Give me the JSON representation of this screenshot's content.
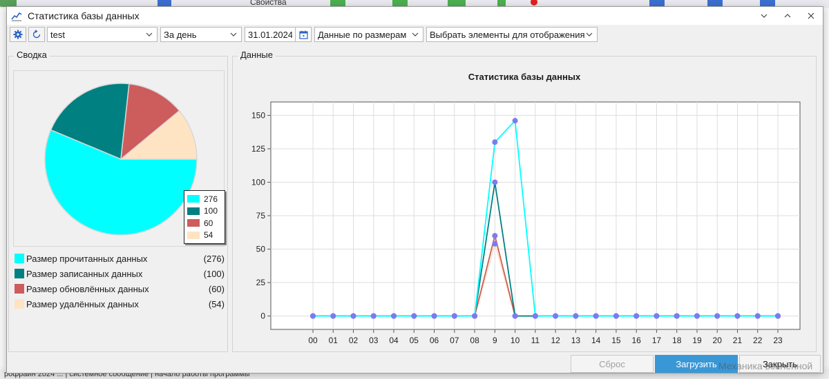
{
  "background": {
    "toolbar_label": "Свойства",
    "status_text": "рофрайн 2024 ... | системное сообщение | начало работы программы"
  },
  "window": {
    "title": "Статистика базы данных",
    "title_icon": "line-chart-icon"
  },
  "toolbar": {
    "database_value": "test",
    "period_value": "За день",
    "date_value": "31.01.2024",
    "mode_value": "Данные по размерам",
    "elements_value": "Выбрать элементы для отображения"
  },
  "summary": {
    "group_title": "Сводка",
    "items": [
      {
        "label": "Размер прочитанных данных",
        "count_text": "(276)",
        "value": 276,
        "color": "#00ffff"
      },
      {
        "label": "Размер записанных данных",
        "count_text": "(100)",
        "value": 100,
        "color": "#008080"
      },
      {
        "label": "Размер обновлённых данных",
        "count_text": "(60)",
        "value": 60,
        "color": "#cd5c5c"
      },
      {
        "label": "Размер удалённых данных",
        "count_text": "(54)",
        "value": 54,
        "color": "#ffe4c4"
      }
    ],
    "pie_legend": [
      "276",
      "100",
      "60",
      "54"
    ]
  },
  "data_panel": {
    "group_title": "Данные"
  },
  "chart_data": [
    {
      "type": "pie",
      "categories": [
        "Размер прочитанных данных",
        "Размер записанных данных",
        "Размер обновлённых данных",
        "Размер удалённых данных"
      ],
      "values": [
        276,
        100,
        60,
        54
      ],
      "colors": [
        "#00ffff",
        "#008080",
        "#cd5c5c",
        "#ffe4c4"
      ],
      "legend": "right-bottom"
    },
    {
      "type": "line",
      "title": "Статистика базы данных",
      "categories": [
        "00",
        "01",
        "02",
        "03",
        "04",
        "05",
        "06",
        "07",
        "08",
        "9",
        "10",
        "11",
        "12",
        "13",
        "14",
        "15",
        "16",
        "17",
        "18",
        "19",
        "20",
        "21",
        "22",
        "23"
      ],
      "yticks": [
        "0",
        "25",
        "50",
        "75",
        "100",
        "125",
        "150"
      ],
      "ylim": [
        -10,
        160
      ],
      "grid": true,
      "marker_color": "#7b7bf0",
      "series": [
        {
          "color": "#00ffff",
          "values": [
            0,
            0,
            0,
            0,
            0,
            0,
            0,
            0,
            0,
            130,
            146,
            0,
            0,
            0,
            0,
            0,
            0,
            0,
            0,
            0,
            0,
            0,
            0,
            0
          ]
        },
        {
          "color": "#008080",
          "values": [
            0,
            0,
            0,
            0,
            0,
            0,
            0,
            0,
            0,
            100,
            0,
            0,
            0,
            0,
            0,
            0,
            0,
            0,
            0,
            0,
            0,
            0,
            0,
            0
          ]
        },
        {
          "color": "#cd5c5c",
          "values": [
            0,
            0,
            0,
            0,
            0,
            0,
            0,
            0,
            0,
            60,
            0,
            0,
            0,
            0,
            0,
            0,
            0,
            0,
            0,
            0,
            0,
            0,
            0,
            0
          ]
        },
        {
          "color": "#ffe4c4",
          "values": [
            0,
            0,
            0,
            0,
            0,
            0,
            0,
            0,
            0,
            54,
            0,
            0,
            0,
            0,
            0,
            0,
            0,
            0,
            0,
            0,
            0,
            0,
            0,
            0
          ]
        }
      ]
    }
  ],
  "footer": {
    "reset_label": "Сброс",
    "load_label": "Загрузить",
    "close_label": "Закрыть",
    "watermark": "Механика вселенной"
  }
}
